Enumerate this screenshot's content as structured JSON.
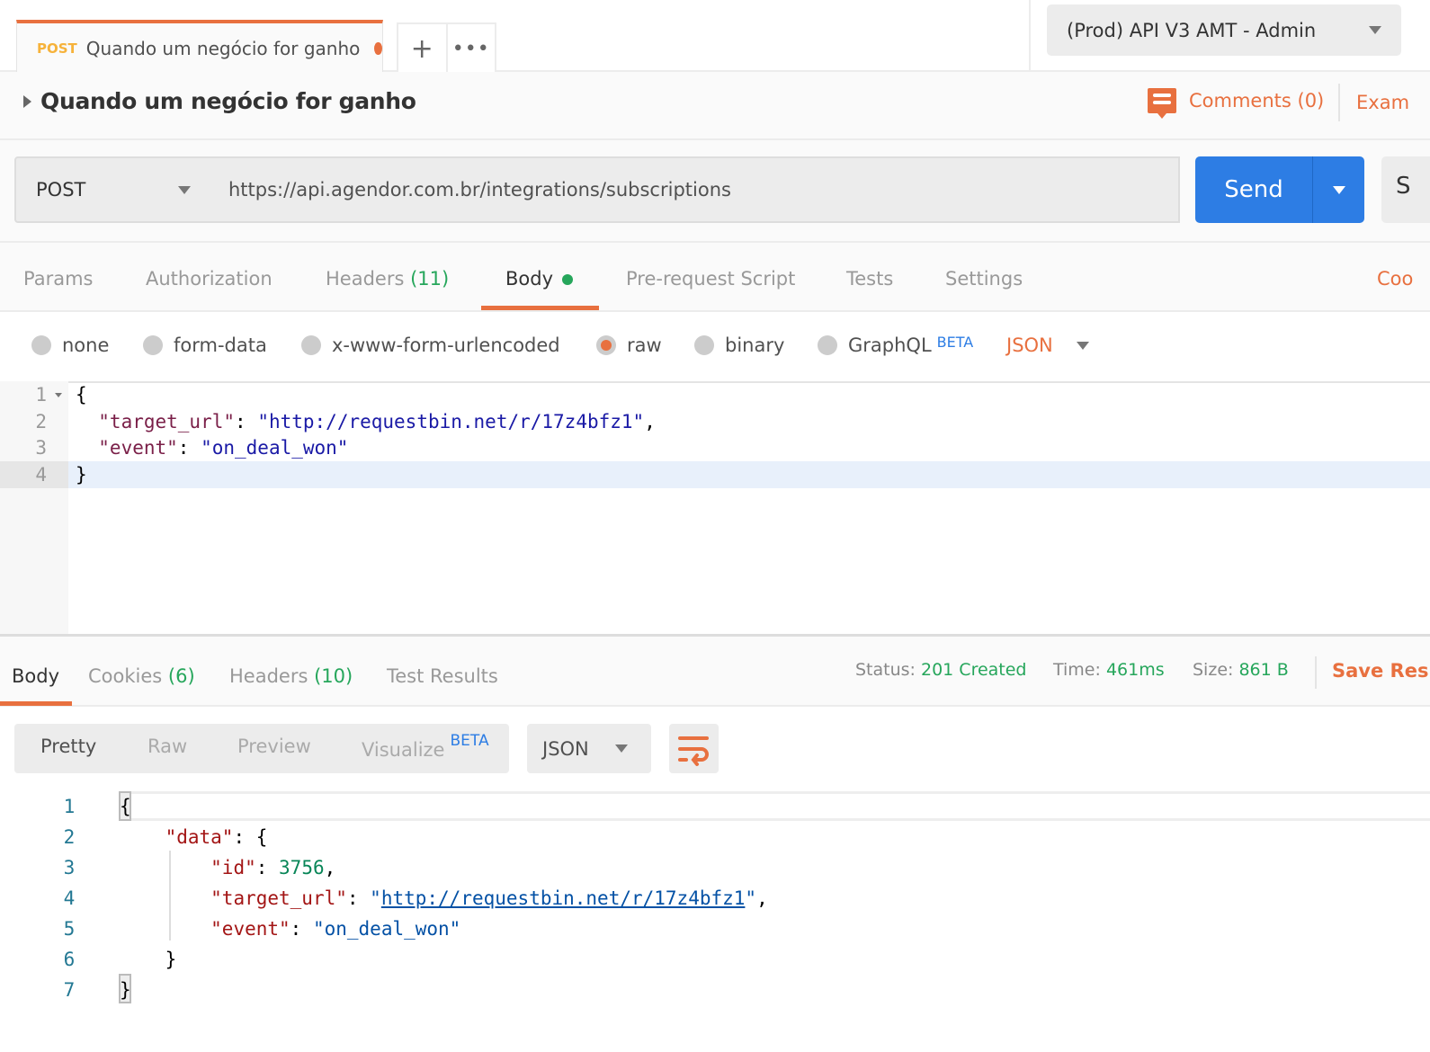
{
  "tabs": [
    {
      "method": "POST",
      "name": "Quando um negócio for ganho",
      "unsaved": true
    }
  ],
  "tab_actions": {
    "add": "+",
    "more": "•••"
  },
  "environment": {
    "selected": "(Prod) API V3 AMT - Admin"
  },
  "request": {
    "title": "Quando um negócio for ganho",
    "comments": "Comments (0)",
    "examples": "Exam",
    "method": "POST",
    "url": "https://api.agendor.com.br/integrations/subscriptions",
    "send": "Send",
    "save": "S"
  },
  "request_tabs": [
    {
      "label": "Params"
    },
    {
      "label": "Authorization"
    },
    {
      "label": "Headers",
      "count": "(11)"
    },
    {
      "label": "Body",
      "active": true
    },
    {
      "label": "Pre-request Script"
    },
    {
      "label": "Tests"
    },
    {
      "label": "Settings"
    }
  ],
  "code_link": "Coo",
  "body_types": [
    {
      "label": "none"
    },
    {
      "label": "form-data"
    },
    {
      "label": "x-www-form-urlencoded"
    },
    {
      "label": "raw",
      "selected": true
    },
    {
      "label": "binary"
    },
    {
      "label": "GraphQL",
      "badge": "BETA"
    }
  ],
  "body_format": "JSON",
  "request_body": [
    {
      "n": "1",
      "parts": [
        [
          "p",
          "{"
        ]
      ]
    },
    {
      "n": "2",
      "parts": [
        [
          "k1",
          "  \"target_url\""
        ],
        [
          "p",
          ": "
        ],
        [
          "s1",
          "\"http://requestbin.net/r/17z4bfz1\""
        ],
        [
          "p",
          ","
        ]
      ]
    },
    {
      "n": "3",
      "parts": [
        [
          "k1",
          "  \"event\""
        ],
        [
          "p",
          ": "
        ],
        [
          "s1",
          "\"on_deal_won\""
        ]
      ]
    },
    {
      "n": "4",
      "parts": [
        [
          "p",
          "}"
        ]
      ]
    }
  ],
  "response_tabs": [
    {
      "label": "Body",
      "active": true
    },
    {
      "label": "Cookies",
      "count": "(6)"
    },
    {
      "label": "Headers",
      "count": "(10)"
    },
    {
      "label": "Test Results"
    }
  ],
  "response_meta": {
    "status_label": "Status:",
    "status": "201 Created",
    "time_label": "Time:",
    "time": "461ms",
    "size_label": "Size:",
    "size": "861 B",
    "save": "Save Res"
  },
  "view_modes": [
    {
      "label": "Pretty",
      "active": true
    },
    {
      "label": "Raw"
    },
    {
      "label": "Preview"
    },
    {
      "label": "Visualize",
      "badge": "BETA"
    }
  ],
  "response_format": "JSON",
  "response_body": [
    {
      "n": "1",
      "parts": [
        [
          "p",
          "{"
        ]
      ]
    },
    {
      "n": "2",
      "parts": [
        [
          "p",
          "    "
        ],
        [
          "k2",
          "\"data\""
        ],
        [
          "p",
          ": {"
        ]
      ]
    },
    {
      "n": "3",
      "parts": [
        [
          "p",
          "        "
        ],
        [
          "k2",
          "\"id\""
        ],
        [
          "p",
          ": "
        ],
        [
          "n2",
          "3756"
        ],
        [
          "p",
          ","
        ]
      ]
    },
    {
      "n": "4",
      "parts": [
        [
          "p",
          "        "
        ],
        [
          "k2",
          "\"target_url\""
        ],
        [
          "p",
          ": "
        ],
        [
          "s2",
          "\""
        ],
        [
          "s2 lnk",
          "http://requestbin.net/r/17z4bfz1"
        ],
        [
          "s2",
          "\""
        ],
        [
          "p",
          ","
        ]
      ]
    },
    {
      "n": "5",
      "parts": [
        [
          "p",
          "        "
        ],
        [
          "k2",
          "\"event\""
        ],
        [
          "p",
          ": "
        ],
        [
          "s2",
          "\"on_deal_won\""
        ]
      ]
    },
    {
      "n": "6",
      "parts": [
        [
          "p",
          "    }"
        ]
      ]
    },
    {
      "n": "7",
      "parts": [
        [
          "p",
          "}"
        ]
      ]
    }
  ],
  "colors": {
    "accent": "#e8703f",
    "send": "#2d7de4",
    "success": "#26a65b",
    "method_post": "#f6b23a"
  }
}
